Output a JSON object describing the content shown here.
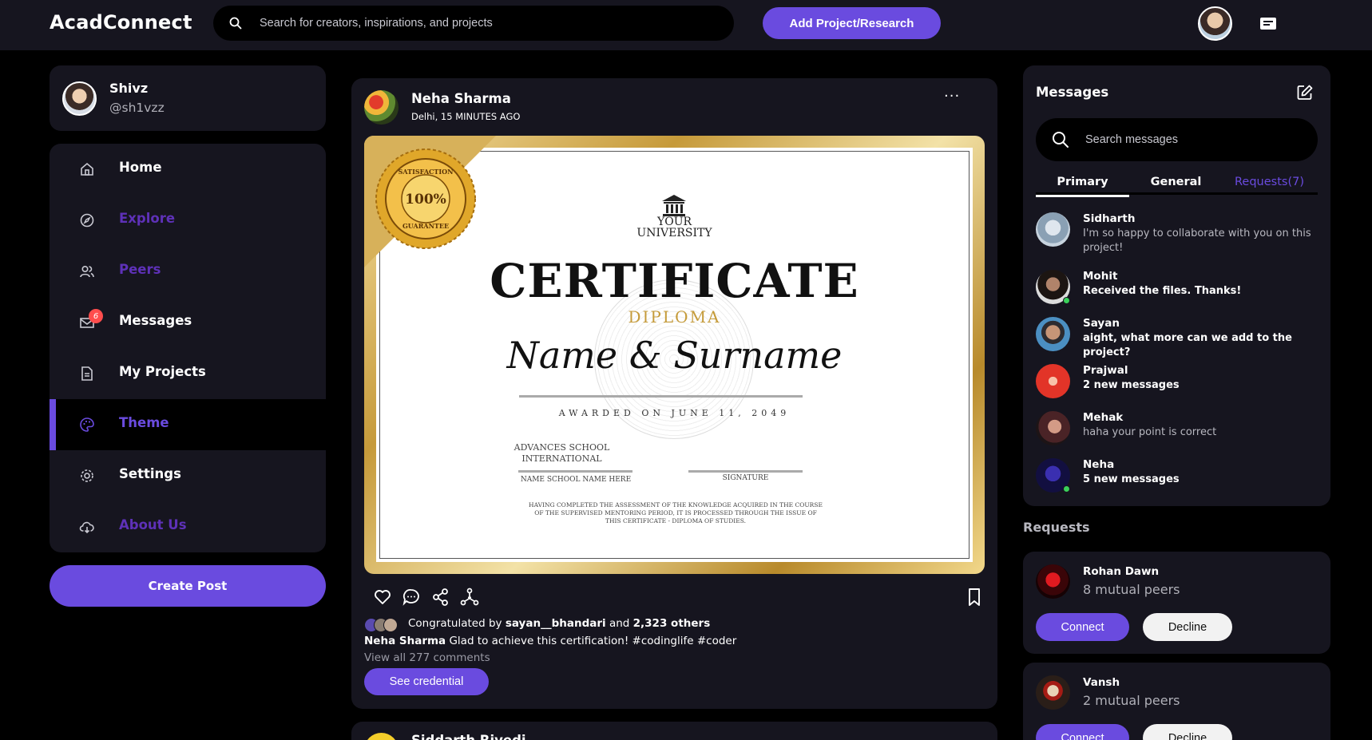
{
  "app": {
    "name": "AcadConnect"
  },
  "navbar": {
    "search_placeholder": "Search for creators, inspirations, and projects",
    "add_button": "Add Project/Research"
  },
  "profile": {
    "name": "Shivz",
    "handle": "@sh1vzz"
  },
  "sidebar": {
    "items": [
      {
        "label": "Home",
        "icon": "home-icon"
      },
      {
        "label": "Explore",
        "icon": "compass-icon"
      },
      {
        "label": "Peers",
        "icon": "users-icon"
      },
      {
        "label": "Messages",
        "icon": "mail-icon",
        "badge": "6"
      },
      {
        "label": "My Projects",
        "icon": "document-icon"
      },
      {
        "label": "Theme",
        "icon": "palette-icon",
        "active": true
      },
      {
        "label": "Settings",
        "icon": "gear-icon"
      },
      {
        "label": "About Us",
        "icon": "cloud-icon"
      }
    ],
    "create_post": "Create Post"
  },
  "post": {
    "author": "Neha Sharma",
    "meta": "Delhi, 15 MINUTES AGO",
    "more": "···",
    "certificate": {
      "university_line1": "YOUR",
      "university_line2": "UNIVERSITY",
      "title": "CERTIFICATE",
      "subtitle": "DIPLOMA",
      "name": "Name & Surname",
      "awarded": "AWARDED ON JUNE 11, 2049",
      "school_line1": "ADVANCES SCHOOL",
      "school_line2": "INTERNATIONAL",
      "school_label": "NAME SCHOOL NAME HERE",
      "signature_label": "SIGNATURE",
      "fine_print_1": "HAVING COMPLETED THE ASSESSMENT OF THE KNOWLEDGE ACQUIRED IN THE COURSE",
      "fine_print_2": "OF THE SUPERVISED MENTORING PERIOD, IT IS PROCESSED THROUGH THE ISSUE OF",
      "fine_print_3": "THIS CERTIFICATE - DIPLOMA OF STUDIES.",
      "seal_text": "SATISFACTION 100% GUARANTEE"
    },
    "likes": {
      "prefix": "Congratulated by",
      "user": "sayan__bhandari",
      "joiner": "and",
      "others": "2,323 others"
    },
    "caption_author": "Neha Sharma",
    "caption_text": "Glad to achieve this certification! #codinglife #coder",
    "view_comments": "View all 277 comments",
    "see_credential": "See credential"
  },
  "next_post": {
    "author": "Siddarth Rivedi"
  },
  "messages": {
    "title": "Messages",
    "search_placeholder": "Search messages",
    "tabs": [
      "Primary",
      "General",
      "Requests(7)"
    ],
    "items": [
      {
        "name": "Sidharth",
        "text": "I'm so happy to collaborate with you on this project!",
        "style": "dim",
        "online": false
      },
      {
        "name": "Mohit",
        "text": "Received the files. Thanks!",
        "style": "bold",
        "online": true
      },
      {
        "name": "Sayan",
        "text": "aight, what more can we add to the project?",
        "style": "bold",
        "online": false
      },
      {
        "name": "Prajwal",
        "text": "2 new messages",
        "style": "bold",
        "online": false
      },
      {
        "name": "Mehak",
        "text": "haha your point is correct",
        "style": "dim",
        "online": false
      },
      {
        "name": "Neha",
        "text": "5 new messages",
        "style": "bold",
        "online": true
      }
    ]
  },
  "requests": {
    "heading": "Requests",
    "items": [
      {
        "name": "Rohan Dawn",
        "mutual": "8 mutual peers",
        "connect": "Connect",
        "decline": "Decline"
      },
      {
        "name": "Vansh",
        "mutual": "2 mutual peers",
        "connect": "Connect",
        "decline": "Decline"
      }
    ]
  },
  "colors": {
    "accent": "#6a4bdf",
    "panel": "#16151f",
    "background": "#000000",
    "muted_purple": "#5e31b8",
    "badge": "#ff4d4d",
    "online": "#3ad15a",
    "gold": "#c59b3a"
  }
}
